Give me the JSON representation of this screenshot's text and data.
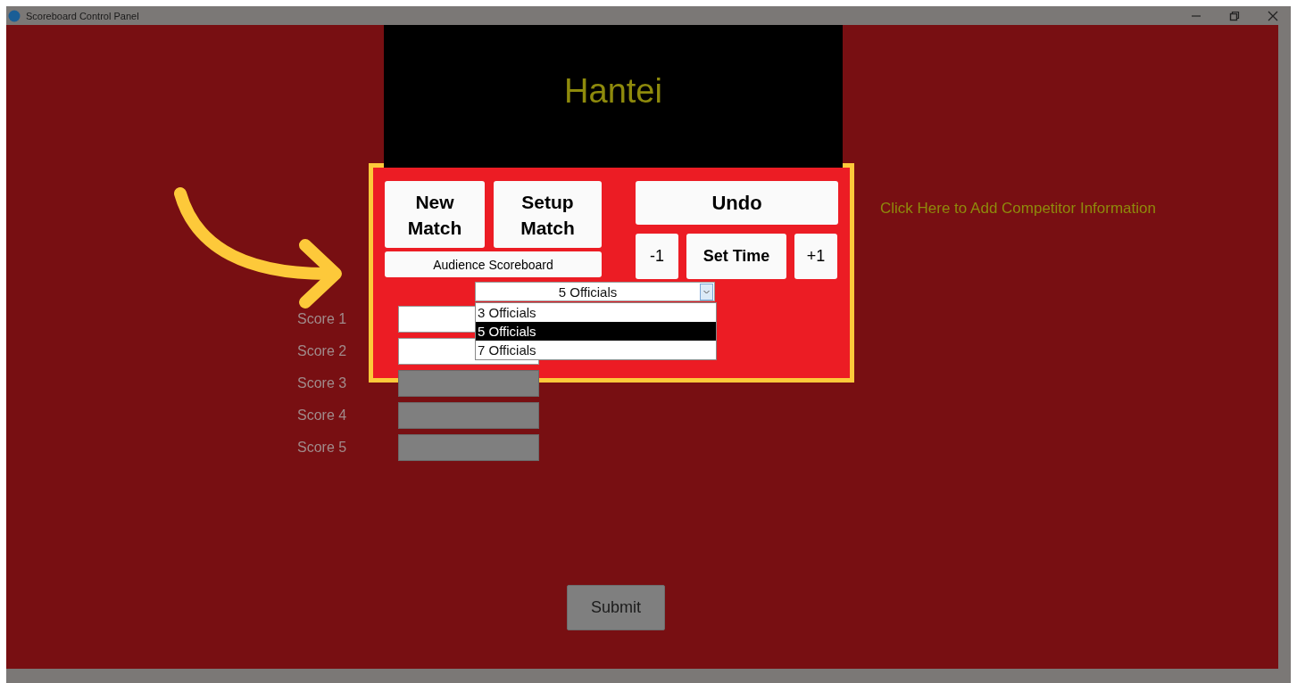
{
  "window": {
    "title": "Scoreboard Control Panel"
  },
  "header": {
    "title": "Hantei"
  },
  "buttons": {
    "new_match": "New\nMatch",
    "setup_match": "Setup\nMatch",
    "audience_scoreboard": "Audience Scoreboard",
    "undo": "Undo",
    "minus": "-1",
    "set_time": "Set Time",
    "plus": "+1"
  },
  "officials": {
    "value": "5 Officials",
    "expanded": true,
    "options": [
      {
        "label": "3 Officials",
        "selected": false
      },
      {
        "label": "5 Officials",
        "selected": true
      },
      {
        "label": "7 Officials",
        "selected": false
      }
    ]
  },
  "scores": [
    {
      "label": "Score 1",
      "disabled": false
    },
    {
      "label": "Score 2",
      "disabled": false
    },
    {
      "label": "Score 3",
      "disabled": true
    },
    {
      "label": "Score 4",
      "disabled": true
    },
    {
      "label": "Score 5",
      "disabled": true
    }
  ],
  "competitor_link": "Click Here to Add Competitor Information",
  "submit": "Submit"
}
